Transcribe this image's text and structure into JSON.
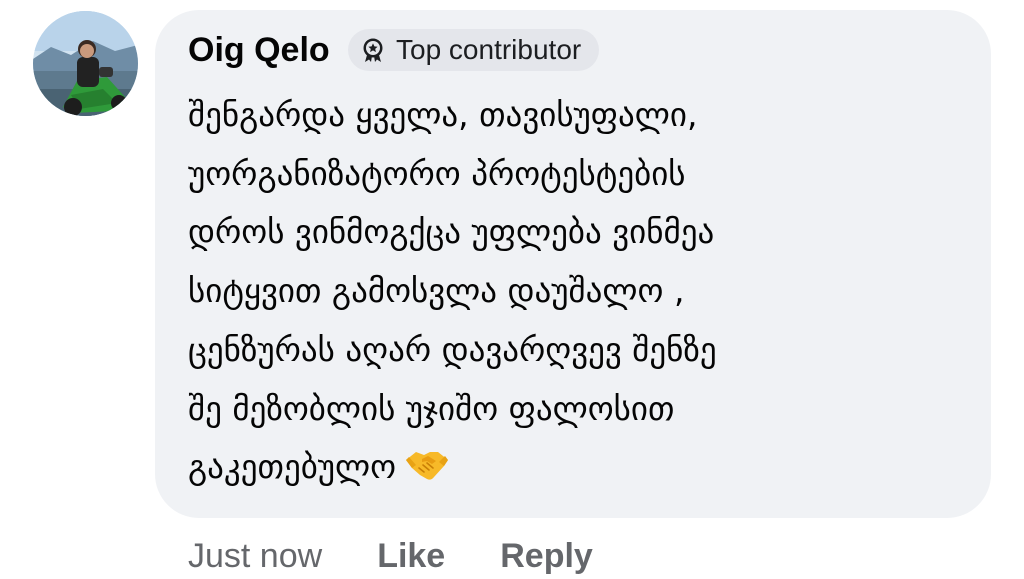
{
  "comment": {
    "author": "Oig Qelo",
    "badge": {
      "label": "Top contributor",
      "icon": "top-contributor-badge-icon"
    },
    "lines": [
      "შენგარდა ყველა, თავისუფალი,",
      "უორგანიზატორო პროტესტების",
      "დროს ვინმოგქცა უფლება ვინმეა",
      "სიტყვით გამოსვლა დაუშალო ,",
      "ცენზურას აღარ დავარღვევ შენზე",
      "შე მეზობლის უჯიშო ფალოსით",
      "გაკეთებულო"
    ],
    "emoji": "handshake-emoji"
  },
  "actions": {
    "time": "Just now",
    "like": "Like",
    "reply": "Reply"
  },
  "colors": {
    "bubble_bg": "#f0f2f5",
    "badge_bg": "#e4e6eb",
    "text": "#050505",
    "meta_text": "#65676b",
    "emoji": "#f7b928"
  }
}
